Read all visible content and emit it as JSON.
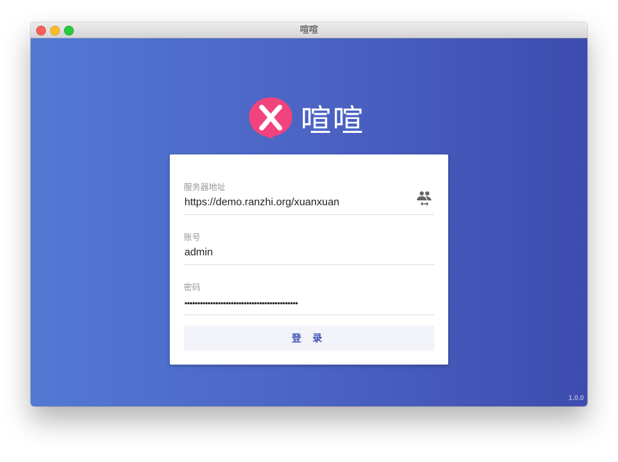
{
  "window": {
    "title": "喧喧"
  },
  "logo": {
    "text": "喧喧",
    "brand_color": "#f1437d"
  },
  "form": {
    "server": {
      "label": "服务器地址",
      "value": "https://demo.ranzhi.org/xuanxuan"
    },
    "account": {
      "label": "账号",
      "value": "admin"
    },
    "password": {
      "label": "密码",
      "value": "••••••••••••••••••••••••••••••••••••••••••••"
    },
    "login_label": "登 录"
  },
  "version": "1.0.0"
}
